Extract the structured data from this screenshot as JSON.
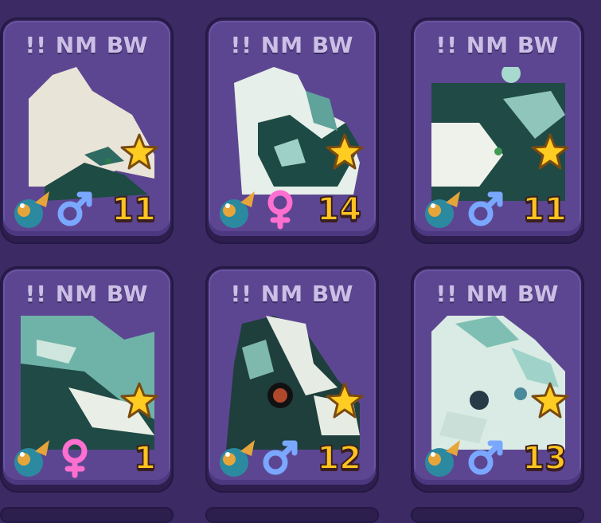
{
  "cards": [
    {
      "name": "!! NM BW",
      "level": "11",
      "gender": "male",
      "rated": true
    },
    {
      "name": "!! NM BW",
      "level": "14",
      "gender": "female",
      "rated": true
    },
    {
      "name": "!! NM BW",
      "level": "11",
      "gender": "male",
      "rated": true
    },
    {
      "name": "!! NM BW",
      "level": "1",
      "gender": "female",
      "rated": true
    },
    {
      "name": "!! NM BW",
      "level": "12",
      "gender": "male",
      "rated": true
    },
    {
      "name": "!! NM BW",
      "level": "13",
      "gender": "male",
      "rated": true
    }
  ],
  "colors": {
    "background": "#3b2a63",
    "card": "#5d4691",
    "name_text": "#cbbfe6",
    "level_text": "#ffc320",
    "male": "#7aa7ff",
    "female": "#ff6fcf",
    "star": "#ffcc22"
  },
  "icons": {
    "star": "star-icon",
    "species": "dragon-icon",
    "male": "male-gender-icon",
    "female": "female-gender-icon"
  }
}
